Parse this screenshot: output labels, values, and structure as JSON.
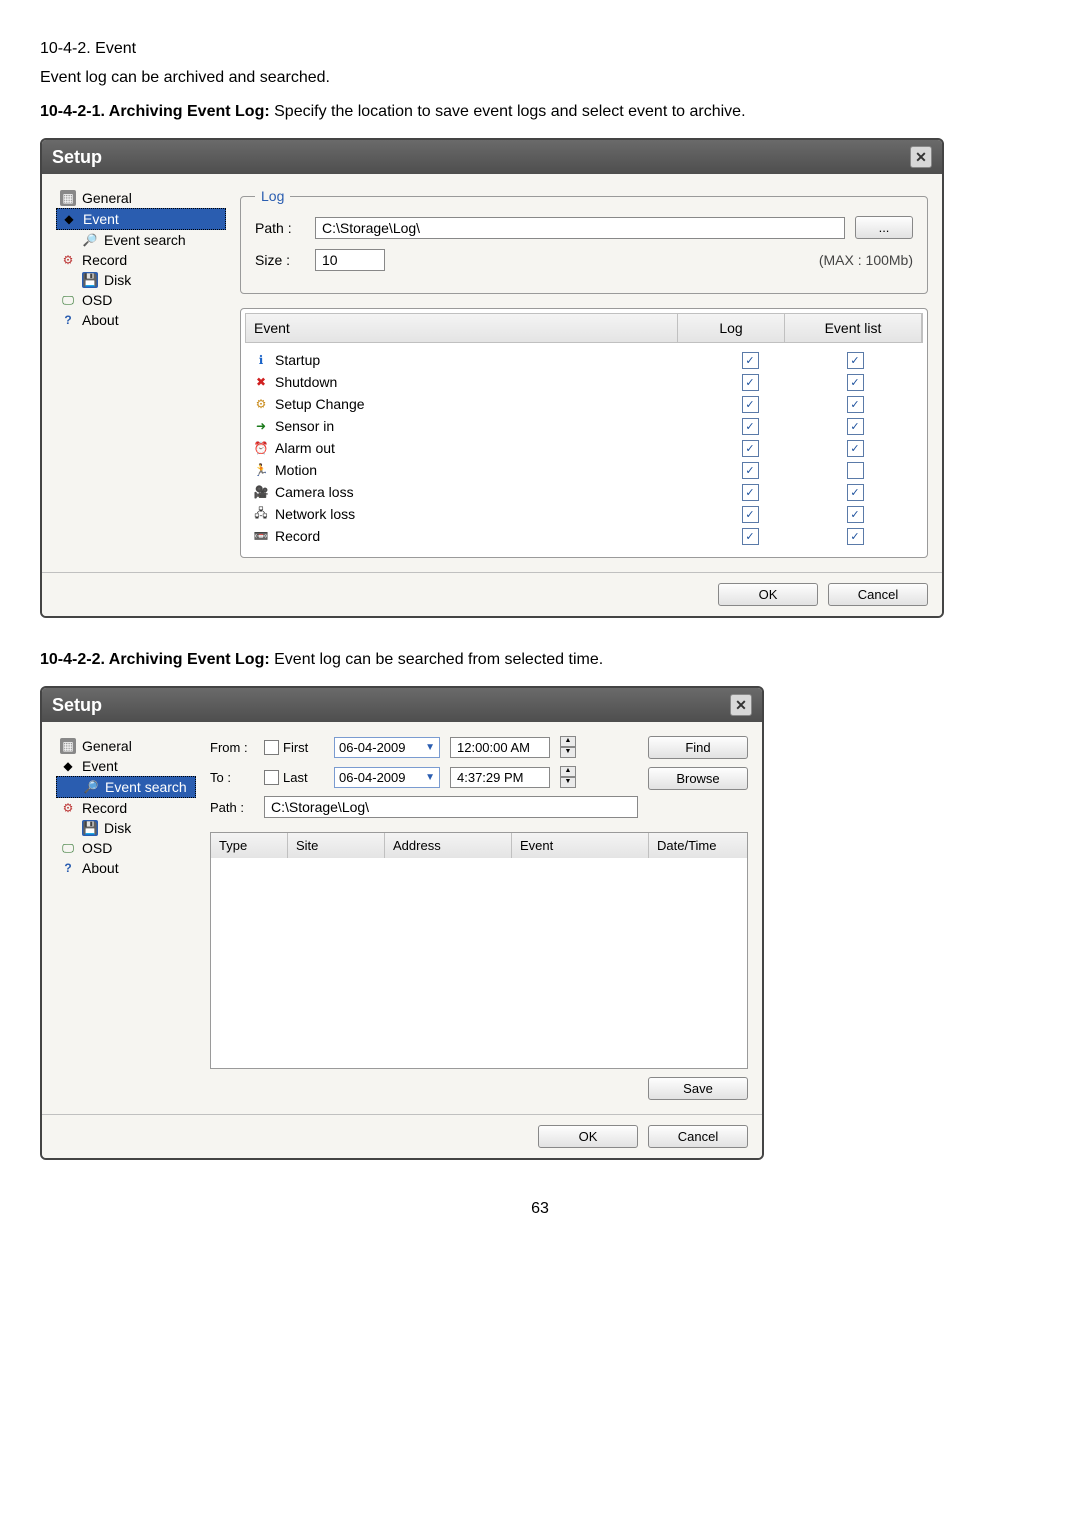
{
  "doc": {
    "section_number": "10-4-2. Event",
    "intro": "Event log can be archived and searched.",
    "sub1_bold": "10-4-2-1. Archiving Event Log: ",
    "sub1_rest": "Specify the location to save event logs and select event to archive.",
    "sub2_bold": "10-4-2-2. Archiving Event Log: ",
    "sub2_rest": "Event log can be searched from selected time.",
    "page": "63"
  },
  "dialog1": {
    "title": "Setup",
    "tree": {
      "general": "General",
      "event": "Event",
      "event_search": "Event search",
      "record": "Record",
      "disk": "Disk",
      "osd": "OSD",
      "about": "About"
    },
    "log": {
      "legend": "Log",
      "path_label": "Path :",
      "path_value": "C:\\Storage\\Log\\",
      "browse": "...",
      "size_label": "Size :",
      "size_value": "10",
      "max": "(MAX : 100Mb)"
    },
    "table": {
      "h_event": "Event",
      "h_log": "Log",
      "h_list": "Event list",
      "rows": [
        {
          "icon": "ℹ",
          "color": "#1a63c8",
          "name": "Startup",
          "log": true,
          "list": true
        },
        {
          "icon": "✖",
          "color": "#d02020",
          "name": "Shutdown",
          "log": true,
          "list": true
        },
        {
          "icon": "⚙",
          "color": "#c88a1a",
          "name": "Setup Change",
          "log": true,
          "list": true
        },
        {
          "icon": "➜",
          "color": "#1a7a1a",
          "name": "Sensor in",
          "log": true,
          "list": true
        },
        {
          "icon": "⏰",
          "color": "#555",
          "name": "Alarm out",
          "log": true,
          "list": true
        },
        {
          "icon": "🏃",
          "color": "#8a2a8a",
          "name": "Motion",
          "log": true,
          "list": false
        },
        {
          "icon": "🎥",
          "color": "#c02020",
          "name": "Camera loss",
          "log": true,
          "list": true
        },
        {
          "icon": "🖧",
          "color": "#333",
          "name": "Network loss",
          "log": true,
          "list": true
        },
        {
          "icon": "📼",
          "color": "#333",
          "name": "Record",
          "log": true,
          "list": true
        }
      ]
    },
    "buttons": {
      "ok": "OK",
      "cancel": "Cancel"
    }
  },
  "dialog2": {
    "title": "Setup",
    "tree": {
      "general": "General",
      "event": "Event",
      "event_search": "Event search",
      "record": "Record",
      "disk": "Disk",
      "osd": "OSD",
      "about": "About"
    },
    "form": {
      "from": "From :",
      "to": "To :",
      "first": "First",
      "last": "Last",
      "date1": "06-04-2009",
      "date2": "06-04-2009",
      "time1": "12:00:00 AM",
      "time2": "4:37:29 PM",
      "path_label": "Path  :",
      "path_value": "C:\\Storage\\Log\\",
      "find": "Find",
      "browse": "Browse",
      "save": "Save"
    },
    "result": {
      "type": "Type",
      "site": "Site",
      "address": "Address",
      "event": "Event",
      "dt": "Date/Time"
    },
    "buttons": {
      "ok": "OK",
      "cancel": "Cancel"
    }
  }
}
